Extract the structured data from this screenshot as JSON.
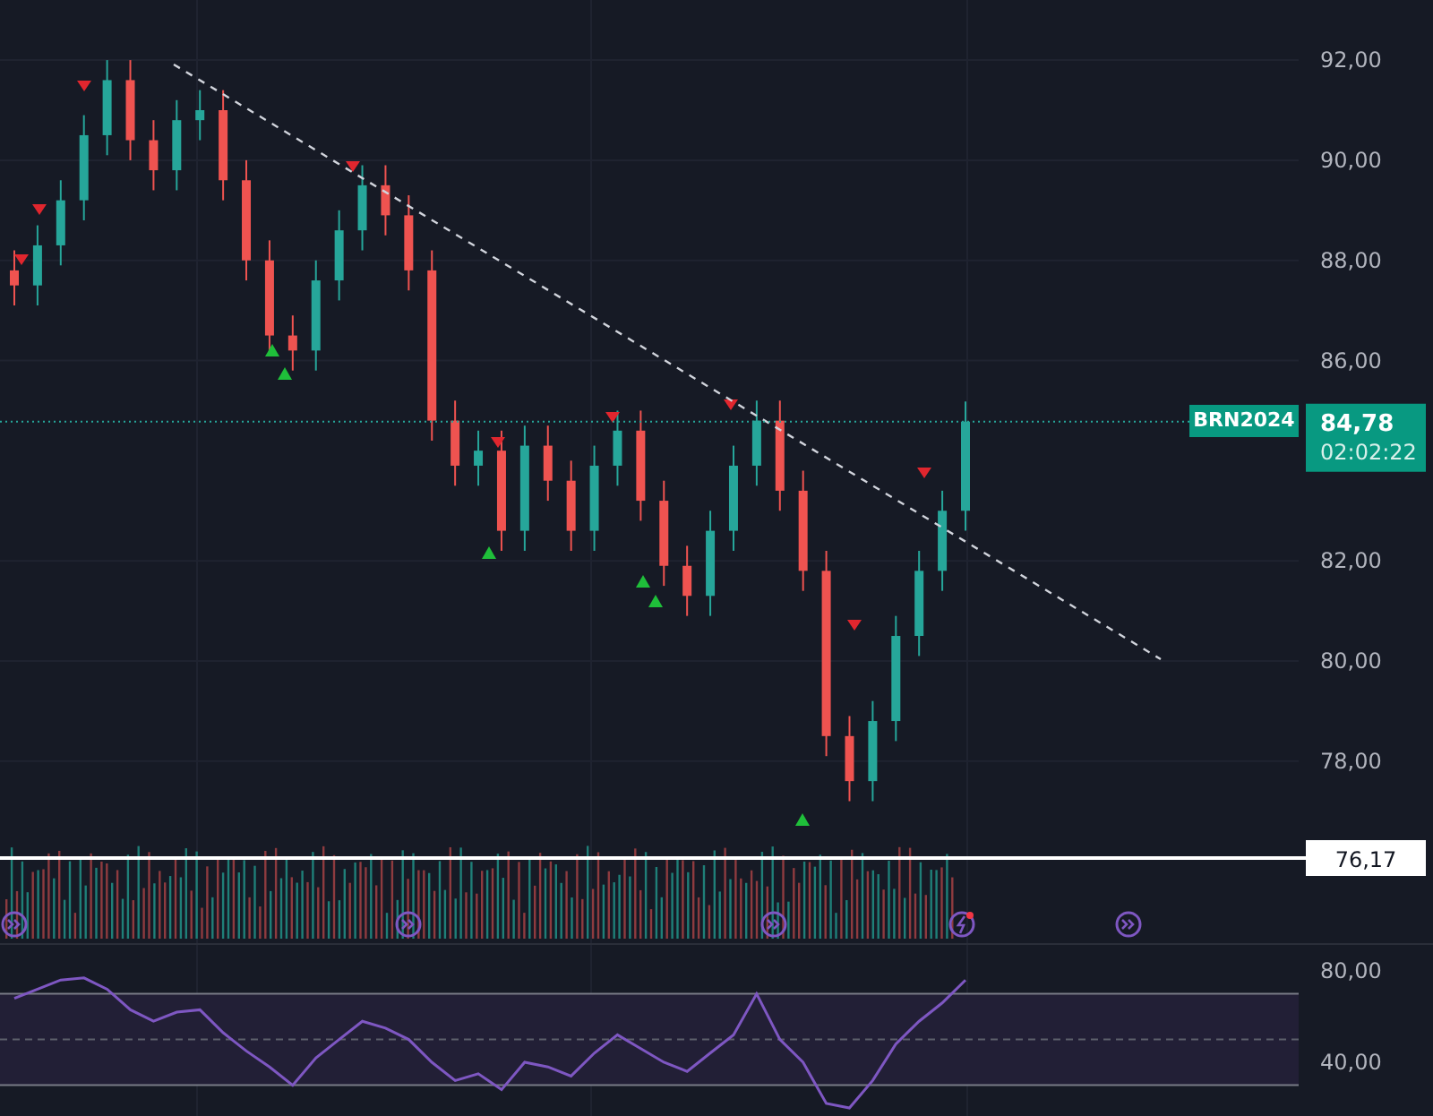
{
  "price_chart": {
    "symbol_label": "BRN2024",
    "last_price": "84,78",
    "countdown": "02:02:22",
    "level_line": "76,17",
    "axis_labels": [
      "92,00",
      "90,00",
      "88,00",
      "86,00",
      "82,00",
      "80,00",
      "78,00"
    ]
  },
  "rsi_pane": {
    "axis_labels": [
      "80,00",
      "40,00"
    ]
  }
}
